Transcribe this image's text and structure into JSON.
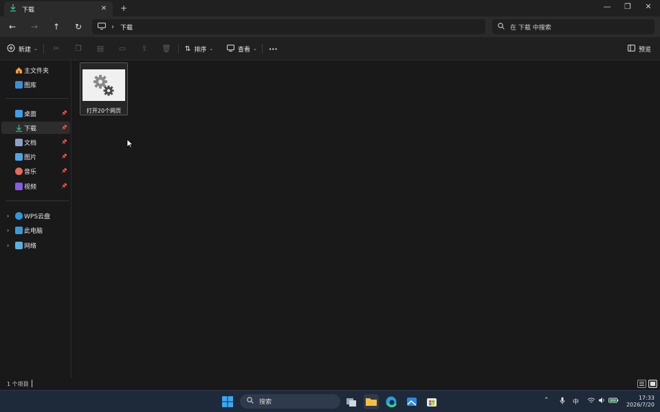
{
  "window": {
    "tab_title": "下载",
    "tab_close": "✕",
    "new_tab": "+",
    "minimize": "—",
    "maximize": "❐",
    "close": "✕"
  },
  "nav": {
    "back": "←",
    "forward": "→",
    "up": "↑",
    "refresh": "↻",
    "breadcrumb_separator": "›",
    "current_folder": "下载",
    "search_placeholder": "在 下载 中搜索"
  },
  "toolbar": {
    "new_label": "新建",
    "sort_label": "排序",
    "view_label": "查看",
    "more_label": "···",
    "preview_label": "预览"
  },
  "sidebar": {
    "home": "主文件夹",
    "gallery": "图库",
    "pinned": [
      {
        "label": "桌面",
        "icon": "desktop-icon",
        "color": "#3aa0e8"
      },
      {
        "label": "下载",
        "icon": "download-icon",
        "color": "#3fbf8f"
      },
      {
        "label": "文档",
        "icon": "document-icon",
        "color": "#8aa4c8"
      },
      {
        "label": "图片",
        "icon": "pictures-icon",
        "color": "#4aa8e8"
      },
      {
        "label": "音乐",
        "icon": "music-icon",
        "color": "#e86a5a"
      },
      {
        "label": "视频",
        "icon": "videos-icon",
        "color": "#8a5ae8"
      }
    ],
    "locations": [
      {
        "label": "WPS云盘",
        "icon": "cloud-icon"
      },
      {
        "label": "此电脑",
        "icon": "computer-icon"
      },
      {
        "label": "网络",
        "icon": "network-icon"
      }
    ]
  },
  "files": [
    {
      "name": "打开20个网页",
      "icon": "gear-icon"
    }
  ],
  "status": {
    "item_count": "1 个项目"
  },
  "taskbar": {
    "search_label": "搜索",
    "ime": "中",
    "time": "17:33",
    "date": "2026/7/20"
  },
  "colors": {
    "accent": "#0078d4",
    "background": "#191919",
    "taskbar": "#1e2a3a"
  }
}
